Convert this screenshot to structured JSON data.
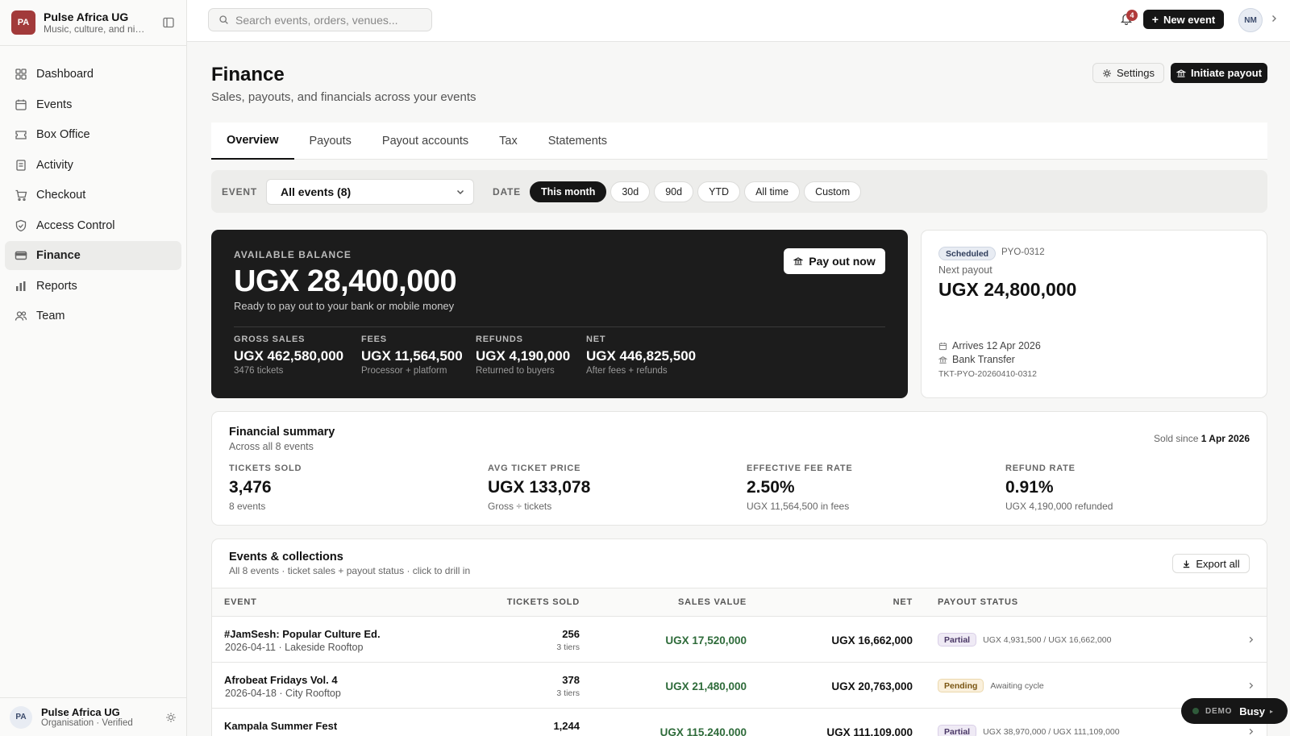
{
  "org": {
    "initials": "PA",
    "name": "Pulse Africa UG",
    "tagline": "Music, culture, and nightlife"
  },
  "nav": [
    {
      "label": "Dashboard",
      "icon": "grid-icon"
    },
    {
      "label": "Events",
      "icon": "calendar-icon"
    },
    {
      "label": "Box Office",
      "icon": "ticket-icon"
    },
    {
      "label": "Activity",
      "icon": "clipboard-icon"
    },
    {
      "label": "Checkout",
      "icon": "cart-icon"
    },
    {
      "label": "Access Control",
      "icon": "shield-icon"
    },
    {
      "label": "Finance",
      "icon": "card-icon",
      "active": true
    },
    {
      "label": "Reports",
      "icon": "bar-chart-icon"
    },
    {
      "label": "Team",
      "icon": "users-icon"
    }
  ],
  "footer": {
    "initials": "PA",
    "name": "Pulse Africa UG",
    "sub": "Organisation · Verified"
  },
  "topbar": {
    "search_placeholder": "Search events, orders, venues...",
    "notif_count": "4",
    "new_event_label": "New event",
    "user_initials": "NM"
  },
  "page": {
    "title": "Finance",
    "subtitle": "Sales, payouts, and financials across your events",
    "settings_label": "Settings",
    "initiate_label": "Initiate payout"
  },
  "tabs": [
    "Overview",
    "Payouts",
    "Payout accounts",
    "Tax",
    "Statements"
  ],
  "filters": {
    "event_label": "EVENT",
    "event_value": "All events (8)",
    "date_label": "DATE",
    "date_options": [
      "This month",
      "30d",
      "90d",
      "YTD",
      "All time",
      "Custom"
    ],
    "date_selected": "This month"
  },
  "balance": {
    "label": "AVAILABLE BALANCE",
    "amount": "UGX 28,400,000",
    "note": "Ready to pay out to your bank or mobile money",
    "button": "Pay out now",
    "stats": [
      {
        "label": "GROSS SALES",
        "value": "UGX 462,580,000",
        "sub": "3476 tickets"
      },
      {
        "label": "FEES",
        "value": "UGX 11,564,500",
        "sub": "Processor + platform"
      },
      {
        "label": "REFUNDS",
        "value": "UGX 4,190,000",
        "sub": "Returned to buyers"
      },
      {
        "label": "NET",
        "value": "UGX 446,825,500",
        "sub": "After fees + refunds"
      }
    ]
  },
  "next_payout": {
    "status": "Scheduled",
    "id": "PYO-0312",
    "label": "Next payout",
    "amount": "UGX 24,800,000",
    "arrives": "Arrives 12 Apr 2026",
    "method": "Bank Transfer",
    "reference": "TKT-PYO-20260410-0312"
  },
  "summary": {
    "title": "Financial summary",
    "subtitle": "Across all 8 events",
    "since_prefix": "Sold since",
    "since_date": "1 Apr 2026",
    "kpis": [
      {
        "label": "TICKETS SOLD",
        "value": "3,476",
        "sub": "8 events"
      },
      {
        "label": "AVG TICKET PRICE",
        "value": "UGX 133,078",
        "sub": "Gross ÷ tickets"
      },
      {
        "label": "EFFECTIVE FEE RATE",
        "value": "2.50%",
        "sub": "UGX 11,564,500 in fees"
      },
      {
        "label": "REFUND RATE",
        "value": "0.91%",
        "sub": "UGX 4,190,000 refunded"
      }
    ]
  },
  "events_table": {
    "title": "Events & collections",
    "subtitle": "All 8 events · ticket sales + payout status · click to drill in",
    "export_label": "Export all",
    "columns": [
      "EVENT",
      "TICKETS SOLD",
      "SALES VALUE",
      "NET",
      "PAYOUT STATUS"
    ],
    "rows": [
      {
        "name": "#JamSesh: Popular Culture Ed.",
        "meta": "2026-04-11 · Lakeside Rooftop",
        "tickets": "256",
        "tiers": "3 tiers",
        "sales": "UGX 17,520,000",
        "net": "UGX 16,662,000",
        "status": "Partial",
        "detail": "UGX 4,931,500 / UGX 16,662,000"
      },
      {
        "name": "Afrobeat Fridays Vol. 4",
        "meta": "2026-04-18 · City Rooftop",
        "tickets": "378",
        "tiers": "3 tiers",
        "sales": "UGX 21,480,000",
        "net": "UGX 20,763,000",
        "status": "Pending",
        "detail": "Awaiting cycle"
      },
      {
        "name": "Kampala Summer Fest",
        "meta": "",
        "tickets": "1,244",
        "tiers": "",
        "sales": "UGX 115,240,000",
        "net": "UGX 111,109,000",
        "status": "Partial",
        "detail": "UGX 38,970,000 / UGX 111,109,000"
      }
    ]
  },
  "demo": {
    "label": "DEMO",
    "status": "Busy"
  }
}
